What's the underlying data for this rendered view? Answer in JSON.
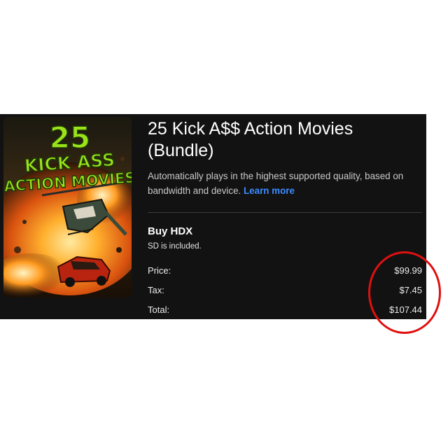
{
  "movie": {
    "title": "25 Kick A$$ Action Movies (Bundle)",
    "description": "Automatically plays in the highest supported quality, based on bandwidth and device.",
    "learn_more": "Learn more",
    "poster": {
      "line1": "25",
      "line2": "KICK ASS",
      "line3": "ACTION MOVIES"
    }
  },
  "purchase": {
    "option": "Buy HDX",
    "note": "SD is included.",
    "price_label": "Price:",
    "price": "$99.99",
    "tax_label": "Tax:",
    "tax": "$7.45",
    "total_label": "Total:",
    "total": "$107.44"
  },
  "colors": {
    "panel_bg": "#121212",
    "link": "#3b8cff",
    "highlight_circle": "#e01010",
    "poster_text": "#9be21a"
  }
}
